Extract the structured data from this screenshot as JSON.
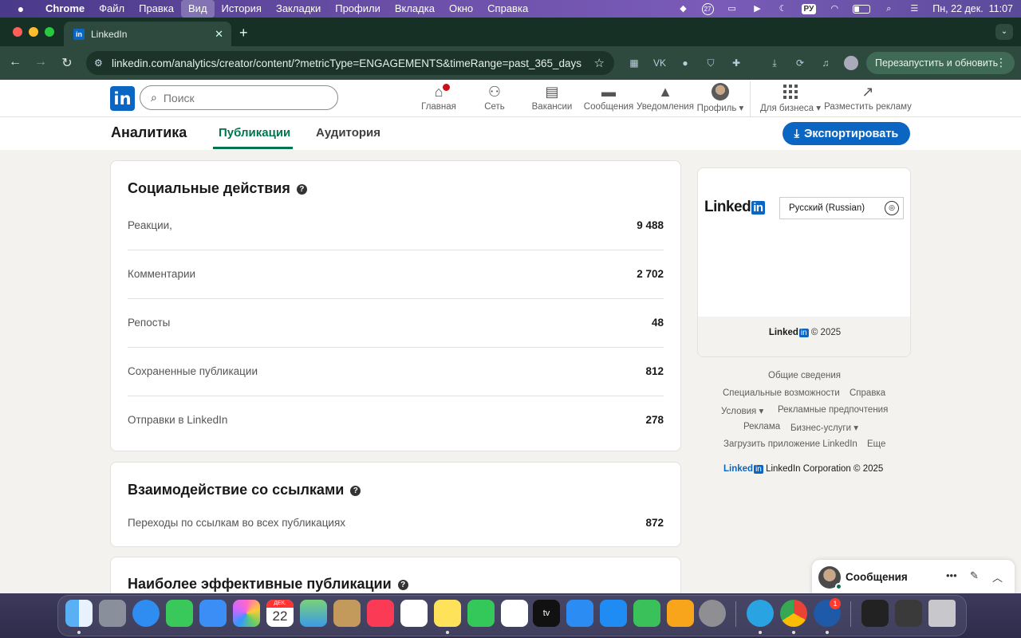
{
  "menubar": {
    "app": "Chrome",
    "items": [
      "Файл",
      "Правка",
      "Вид",
      "История",
      "Закладки",
      "Профили",
      "Вкладка",
      "Окно",
      "Справка"
    ],
    "active_index": 2,
    "notification_count": "27",
    "input_lang": "РУ",
    "datetime": "Пн, 22 дек.  11:07"
  },
  "browser": {
    "tab_title": "LinkedIn",
    "favicon": "in",
    "url": "linkedin.com/analytics/creator/content/?metricType=ENGAGEMENTS&timeRange=past_365_days",
    "relaunch_label": "Перезапустить и обновить"
  },
  "linkedin_nav": {
    "logo": "in",
    "search_placeholder": "Поиск",
    "items": {
      "home": "Главная",
      "network": "Сеть",
      "jobs": "Вакансии",
      "messages": "Сообщения",
      "notifications": "Уведомления",
      "profile": "Профиль",
      "business": "Для бизнеса",
      "advertise": "Разместить рекламу"
    }
  },
  "subheader": {
    "title": "Аналитика",
    "tabs": [
      "Публикации",
      "Аудитория"
    ],
    "active_tab": "Публикации",
    "export_label": "Экспортировать"
  },
  "social_actions": {
    "title": "Социальные действия",
    "rows": [
      {
        "label": "Реакции,",
        "value": "9 488"
      },
      {
        "label": "Комментарии",
        "value": "2 702"
      },
      {
        "label": "Репосты",
        "value": "48"
      },
      {
        "label": "Сохраненные публикации",
        "value": "812"
      },
      {
        "label": "Отправки в LinkedIn",
        "value": "278"
      }
    ]
  },
  "link_engagement": {
    "title": "Взаимодействие со ссылками",
    "rows": [
      {
        "label": "Переходы по ссылкам во всех публикациях",
        "value": "872"
      }
    ]
  },
  "top_posts": {
    "title": "Наиболее эффективные публикации"
  },
  "rail": {
    "logo_text": "Linked",
    "logo_in": "in",
    "language": "Русский (Russian)",
    "copyright": "© 2025"
  },
  "footer": {
    "links": {
      "about": "Общие сведения",
      "accessibility": "Специальные возможности",
      "help": "Справка",
      "terms": "Условия",
      "ad_prefs": "Рекламные предпочтения",
      "ads": "Реклама",
      "business_services": "Бизнес-услуги",
      "get_app": "Загрузить приложение LinkedIn",
      "more": "Еще"
    },
    "corp": "LinkedIn Corporation © 2025"
  },
  "messaging": {
    "title": "Сообщения"
  },
  "dock": {
    "calendar_month": "ДЕК.",
    "calendar_day": "22",
    "appletv_label": "tv",
    "badge": "1"
  }
}
